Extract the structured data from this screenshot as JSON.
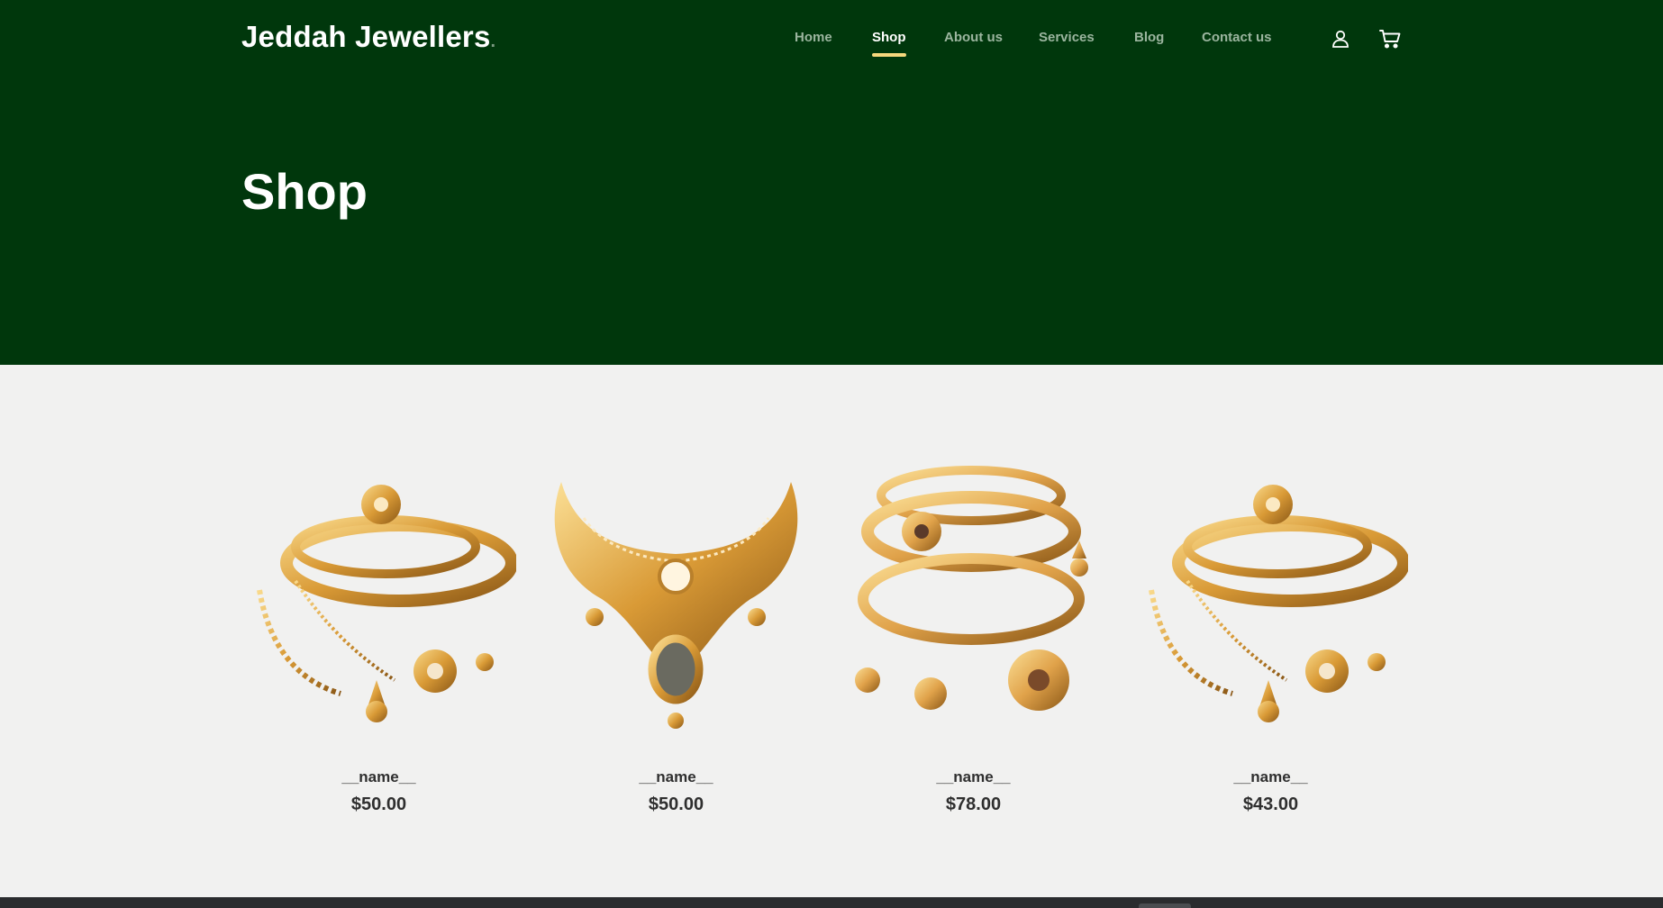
{
  "brand": {
    "name": "Jeddah Jewellers",
    "dot": "."
  },
  "nav": {
    "items": [
      {
        "label": "Home"
      },
      {
        "label": "Shop"
      },
      {
        "label": "About us"
      },
      {
        "label": "Services"
      },
      {
        "label": "Blog"
      },
      {
        "label": "Contact us"
      }
    ],
    "active": "Shop"
  },
  "icons": {
    "user": "user-icon",
    "cart": "cart-icon"
  },
  "hero": {
    "title": "Shop"
  },
  "products": [
    {
      "name": "__name__",
      "price": "$50.00",
      "image": "gold-bangles-jewelry-set"
    },
    {
      "name": "__name__",
      "price": "$50.00",
      "image": "gold-necklace"
    },
    {
      "name": "__name__",
      "price": "$78.00",
      "image": "gold-bangles-earrings"
    },
    {
      "name": "__name__",
      "price": "$43.00",
      "image": "gold-bangles-jewelry-set"
    }
  ],
  "colors": {
    "hero_bg": "#00370c",
    "active_underline": "#f6d87d",
    "page_bg": "#f1f1f0",
    "gold": "#d99a36"
  }
}
